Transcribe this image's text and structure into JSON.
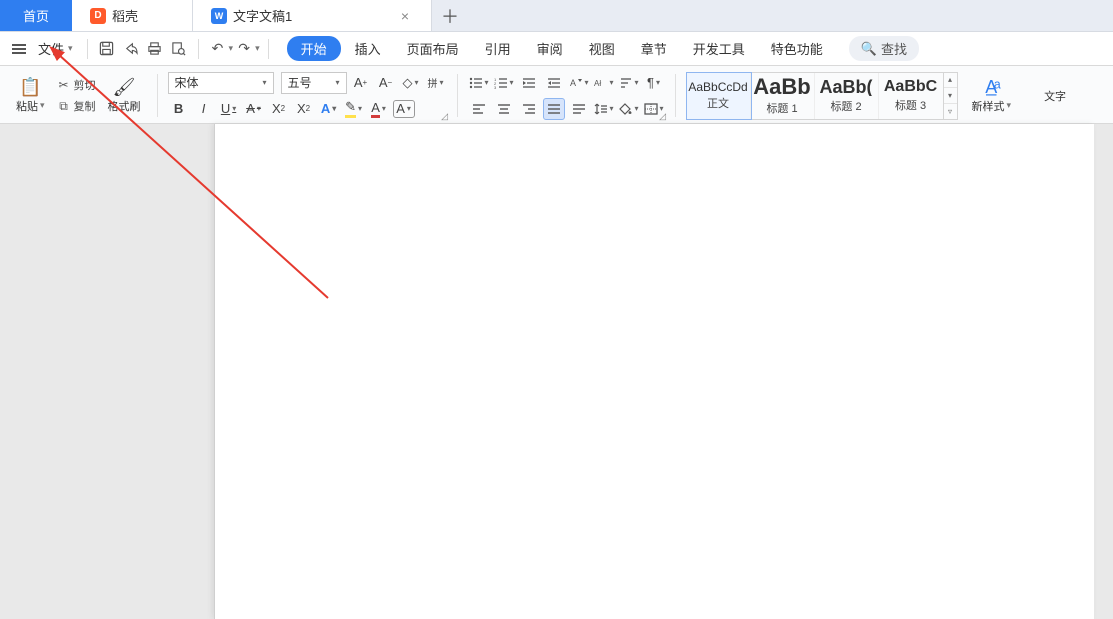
{
  "tabs": {
    "home": "首页",
    "docke": "稻壳",
    "doc": "文字文稿1"
  },
  "file_menu_label": "文件",
  "menu": {
    "items": [
      "开始",
      "插入",
      "页面布局",
      "引用",
      "审阅",
      "视图",
      "章节",
      "开发工具",
      "特色功能"
    ],
    "active_index": 0
  },
  "search_label": "查找",
  "clipboard": {
    "paste": "粘贴",
    "cut": "剪切",
    "copy": "复制",
    "format_painter": "格式刷"
  },
  "font": {
    "name": "宋体",
    "size": "五号"
  },
  "styles": {
    "items": [
      {
        "preview": "AaBbCcDd",
        "name": "正文",
        "size": "12px",
        "weight": "400",
        "selected": true
      },
      {
        "preview": "AaBb",
        "name": "标题 1",
        "size": "22px",
        "weight": "700",
        "selected": false
      },
      {
        "preview": "AaBb(",
        "name": "标题 2",
        "size": "18px",
        "weight": "700",
        "selected": false
      },
      {
        "preview": "AaBbC",
        "name": "标题 3",
        "size": "16px",
        "weight": "700",
        "selected": false
      }
    ],
    "new_style": "新样式",
    "text_tools": "文字"
  },
  "icons": {
    "save": "💾",
    "print": "🖨",
    "preview": "🔍",
    "share": "↻",
    "undo": "↶",
    "redo": "↷",
    "grow_font": "A↑",
    "shrink_font": "A↓",
    "clear_format": "◇",
    "pinyin": "拼",
    "char_border": "A",
    "highlight": "✎",
    "font_color": "A",
    "bucket": "◆"
  }
}
